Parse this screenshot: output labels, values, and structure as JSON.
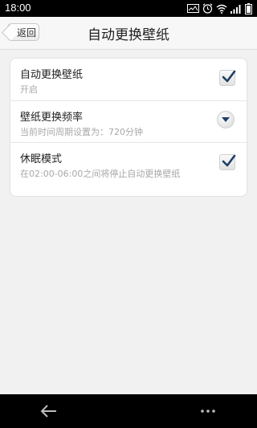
{
  "status": {
    "time": "18:00"
  },
  "header": {
    "back_label": "返回",
    "title": "自动更换壁纸"
  },
  "settings": [
    {
      "title": "自动更换壁纸",
      "subtitle": "开启",
      "control": "checkbox",
      "checked": true
    },
    {
      "title": "壁纸更换频率",
      "subtitle": "当前时间周期设置为：720分钟",
      "control": "dropdown"
    },
    {
      "title": "休眠模式",
      "subtitle": "在02:00-06:00之间将停止自动更换壁纸",
      "control": "checkbox",
      "checked": true
    }
  ],
  "icons": {
    "status": [
      "image-icon",
      "alarm-icon",
      "wifi-icon",
      "signal-icon",
      "battery-icon"
    ],
    "navigation": [
      "back-arrow-icon",
      "more-icon"
    ]
  },
  "colors": {
    "accent": "#1e3f64",
    "subtitle": "#a8a8a8",
    "background": "#f1f1f1"
  }
}
